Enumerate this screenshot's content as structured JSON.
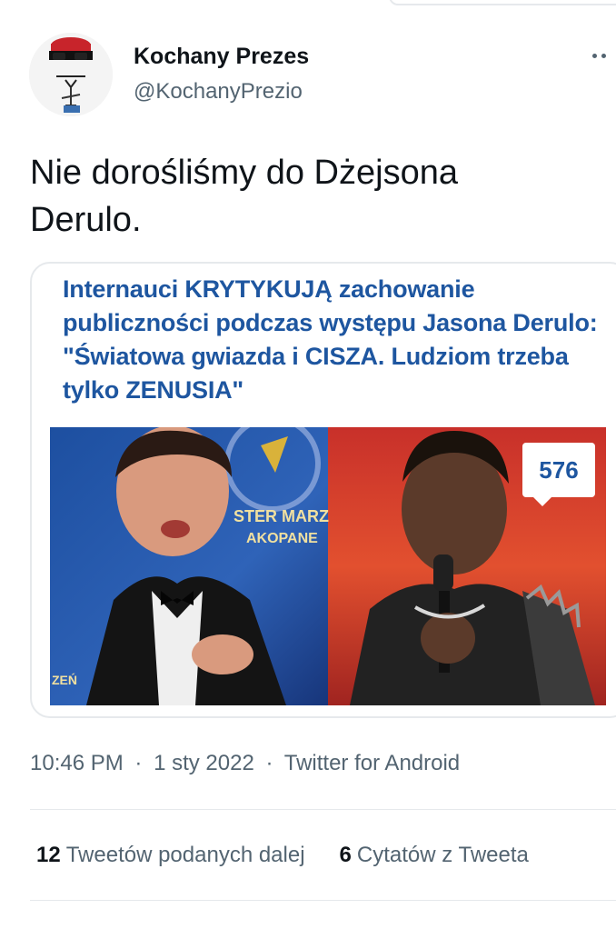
{
  "tweet": {
    "display_name": "Kochany Prezes",
    "handle": "@KochanyPrezio",
    "text": "Nie doroślIśmy do Dżejsona Derulo.",
    "card": {
      "headline": "Internauci KRYTYKUJĄ zachowanie publiczności podczas występu Jasona Derulo: \"Światowa gwiazda i CISZA. Ludziom trzeba tylko ZENUSIA\"",
      "badge": "576",
      "sign_text": "STER MARZ",
      "sign_text2": "AKOPANE",
      "sign_text3": "ZEŃ"
    },
    "time": "10:46 PM",
    "date": "1 sty 2022",
    "client": "Twitter for Android",
    "separator": "·",
    "retweets_count": "12",
    "retweets_label": "Tweetów podanych dalej",
    "quotes_count": "6",
    "quotes_label": "Cytatów z Tweeta"
  },
  "icons": {
    "more": "more-dots-icon"
  },
  "colors": {
    "headline_blue": "#1e56a0",
    "secondary_text": "#536471",
    "border": "#e6e9ec"
  }
}
